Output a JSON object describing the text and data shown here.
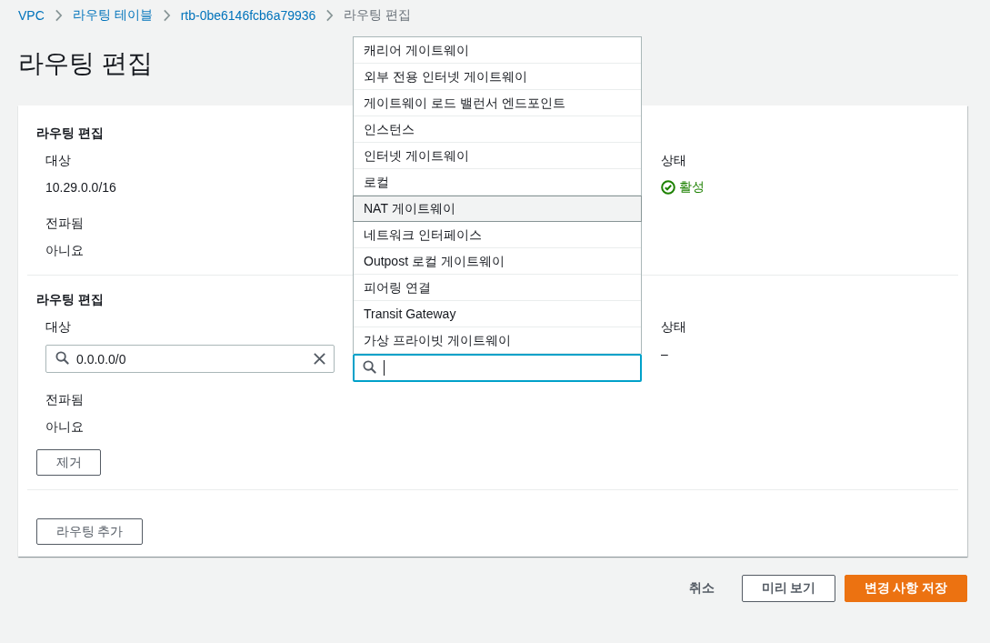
{
  "breadcrumbs": [
    {
      "label": "VPC",
      "link": true
    },
    {
      "label": "라우팅 테이블",
      "link": true
    },
    {
      "label": "rtb-0be6146fcb6a79936",
      "link": true
    },
    {
      "label": "라우팅 편집",
      "link": false
    }
  ],
  "title": "라우팅 편집",
  "routes": [
    {
      "heading": "라우팅 편집",
      "target_label": "대상",
      "target": {
        "kind": "text",
        "value": "10.29.0.0/16"
      },
      "status_label": "상태",
      "status": {
        "kind": "success",
        "text": "활성"
      },
      "propagated_label": "전파됨",
      "propagated": "아니요"
    },
    {
      "heading": "라우팅 편집",
      "target_label": "대상",
      "target": {
        "kind": "input",
        "value": "0.0.0.0/0"
      },
      "target_search": {
        "focused": true,
        "options": [
          {
            "label": "캐리어 게이트웨이",
            "selected": false
          },
          {
            "label": "외부 전용 인터넷 게이트웨이",
            "selected": false
          },
          {
            "label": "게이트웨이 로드 밸런서 엔드포인트",
            "selected": false
          },
          {
            "label": "인스턴스",
            "selected": false
          },
          {
            "label": "인터넷 게이트웨이",
            "selected": false
          },
          {
            "label": "로컬",
            "selected": false
          },
          {
            "label": "NAT 게이트웨이",
            "selected": true
          },
          {
            "label": "네트워크 인터페이스",
            "selected": false
          },
          {
            "label": "Outpost 로컬 게이트웨이",
            "selected": false
          },
          {
            "label": "피어링 연결",
            "selected": false
          },
          {
            "label": "Transit Gateway",
            "selected": false
          },
          {
            "label": "가상 프라이빗 게이트웨이",
            "selected": false
          }
        ]
      },
      "status_label": "상태",
      "status": {
        "kind": "none",
        "text": "–"
      },
      "propagated_label": "전파됨",
      "propagated": "아니요",
      "remove_button": "제거"
    }
  ],
  "add_button": "라우팅 추가",
  "footer": {
    "cancel": "취소",
    "preview": "미리 보기",
    "save": "변경 사항 저장"
  }
}
